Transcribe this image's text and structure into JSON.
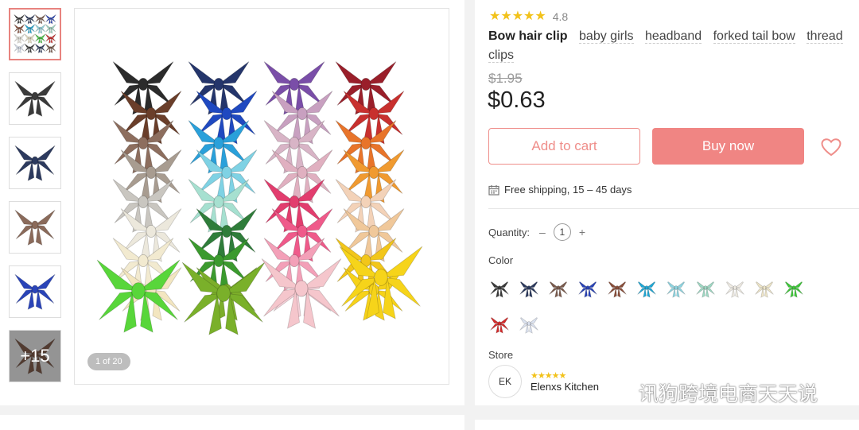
{
  "gallery": {
    "thumbnails": [
      {
        "kind": "all-colors",
        "color": "#e63b6f"
      },
      {
        "kind": "bow",
        "color": "#3a3a3a"
      },
      {
        "kind": "bow",
        "color": "#2c3a5e"
      },
      {
        "kind": "bow",
        "color": "#8a6a5a"
      },
      {
        "kind": "bow",
        "color": "#2a44b8"
      },
      {
        "kind": "more",
        "color": "#6e3a22",
        "label": "+15"
      }
    ],
    "counter": "1 of 20"
  },
  "product": {
    "rating": "4.8",
    "stars": 5,
    "tags": [
      "Bow hair clip",
      "baby girls",
      "headband",
      "forked tail bow",
      "thread",
      "clips"
    ],
    "old_price": "$1.95",
    "price": "$0.63",
    "add_to_cart": "Add to cart",
    "buy_now": "Buy now",
    "shipping": "Free shipping, 15 – 45 days",
    "quantity_label": "Quantity:",
    "quantity_minus": "–",
    "quantity_value": "1",
    "quantity_plus": "+",
    "color_label": "Color",
    "colors": [
      "#3a3a3a",
      "#2c3a5e",
      "#7a5a4c",
      "#2a44b8",
      "#8a4e3a",
      "#1fa8d6",
      "#8fd6e2",
      "#9ed9c4",
      "#f1ede4",
      "#efe6c8",
      "#3fc93a",
      "#d42a2a",
      "#dde4f2"
    ]
  },
  "store": {
    "label": "Store",
    "initials": "EK",
    "stars": "★★★★★",
    "name": "Elenxs Kitchen"
  },
  "watermark": {
    "text": "讯狗跨境电商天天说"
  },
  "theme": {
    "accent": "#f08583",
    "star": "#f2c21a"
  }
}
